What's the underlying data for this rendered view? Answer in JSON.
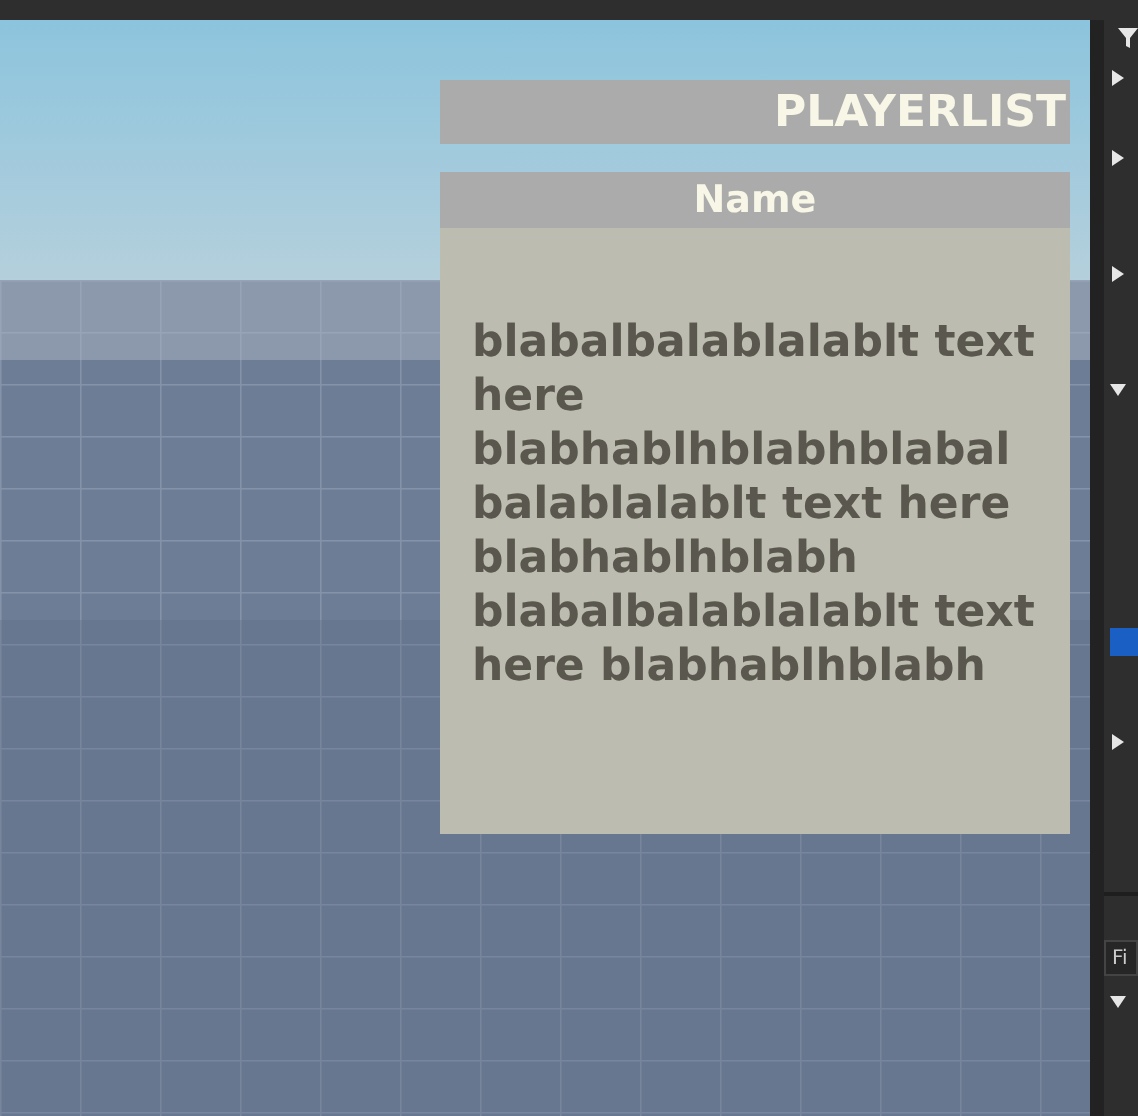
{
  "gui": {
    "title": "PLAYERLIST",
    "column_header": "Name",
    "body_text": "blabalbalablalablt text here blabhablhblabhblabalbalablalablt text here blabhablhblabh blabalbalablalablt text here blabhablhblabh"
  },
  "explorer": {
    "rows": [
      {
        "expanded": false,
        "selected": false
      },
      {
        "expanded": false,
        "selected": false
      },
      {
        "expanded": false,
        "selected": false
      },
      {
        "expanded": true,
        "selected": false
      },
      {
        "selected": true
      },
      {
        "expanded": false,
        "selected": false
      }
    ]
  },
  "properties": {
    "filter_placeholder": "Fi",
    "rows": [
      {
        "expanded": true
      }
    ]
  }
}
